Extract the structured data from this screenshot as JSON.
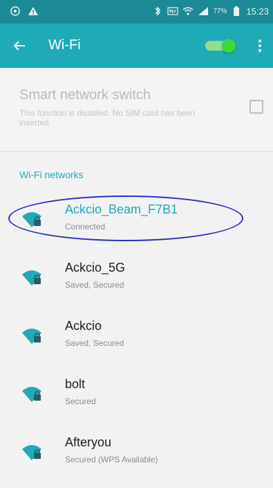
{
  "status_bar": {
    "left_icons": [
      "settings-ring-icon",
      "warning-icon"
    ],
    "right_icons": [
      "bluetooth-icon",
      "nfc-icon",
      "wifi-status-icon",
      "signal-icon",
      "battery-icon"
    ],
    "battery_percent": "77%",
    "time": "15:23"
  },
  "app_bar": {
    "back_icon": "arrow-left-icon",
    "title": "Wi-Fi",
    "wifi_toggle": {
      "on": true
    },
    "more_icon": "more-vert-icon"
  },
  "smart_switch": {
    "title": "Smart network switch",
    "description": "This function is disabled. No SIM card has been inserted.",
    "checked": false
  },
  "networks": {
    "header": "Wi-Fi networks",
    "items": [
      {
        "name": "Ackcio_Beam_F7B1",
        "status": "Connected"
      },
      {
        "name": "Ackcio_5G",
        "status": "Saved, Secured"
      },
      {
        "name": "Ackcio",
        "status": "Saved, Secured"
      },
      {
        "name": "bolt",
        "status": "Secured"
      },
      {
        "name": "Afteryou",
        "status": "Secured (WPS Available)"
      }
    ]
  },
  "colors": {
    "accent": "#1faab8",
    "status_bar": "#1b8a96",
    "toggle_on": "#3ed83a",
    "highlight": "#2a2fc2"
  }
}
